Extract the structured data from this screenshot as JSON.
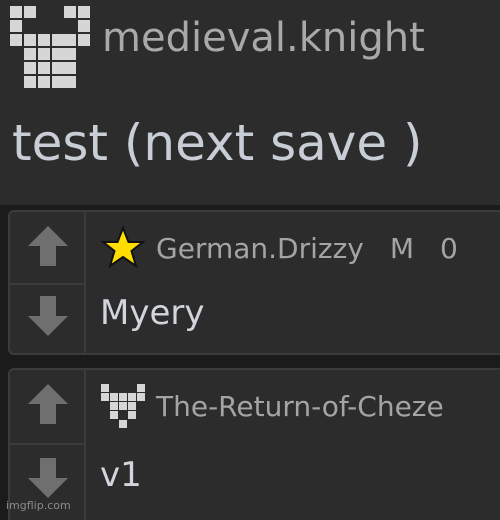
{
  "top_comment": {
    "username": "medieval.knight",
    "message": "test (next save )",
    "avatar_icon": "castle-tower-icon"
  },
  "replies": [
    {
      "username": "German.Drizzy",
      "flag": "M",
      "points": "0",
      "text": "Myery",
      "badge_icon": "gold-star-icon",
      "badge_color": "#ffde00",
      "upvote_icon": "arrow-up-icon",
      "downvote_icon": "arrow-down-icon"
    },
    {
      "username": "The-Return-of-Cheze",
      "text": "v1",
      "badge_icon": "castle-tower-icon",
      "upvote_icon": "arrow-up-icon",
      "downvote_icon": "arrow-down-icon"
    }
  ],
  "watermark": "imgflip.com",
  "colors": {
    "background": "#1b1b1b",
    "panel": "#2c2c2c",
    "border": "#3b3b3b",
    "username": "#a9a9a9",
    "message": "#c9ced6"
  }
}
